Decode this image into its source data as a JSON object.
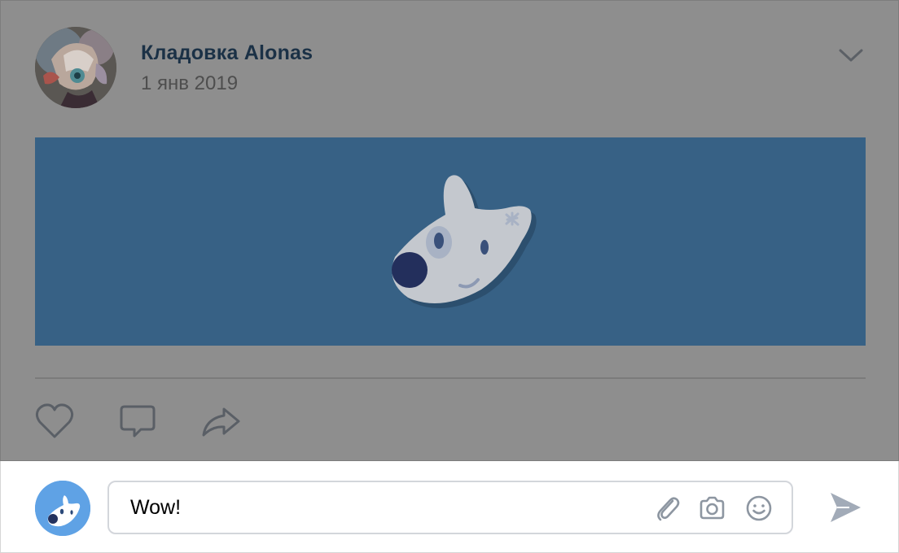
{
  "post": {
    "author": "Кладовка Alonas",
    "date": "1 янв 2019",
    "icons": {
      "menu": "chevron-down-icon",
      "like": "heart-icon",
      "comment": "comment-icon",
      "share": "share-icon"
    },
    "banner_color": "#376185"
  },
  "comment_box": {
    "value": "Wow!",
    "icons": [
      "paperclip-icon",
      "camera-icon",
      "smile-icon",
      "send-icon"
    ],
    "avatar_color": "#5fa2e5"
  }
}
